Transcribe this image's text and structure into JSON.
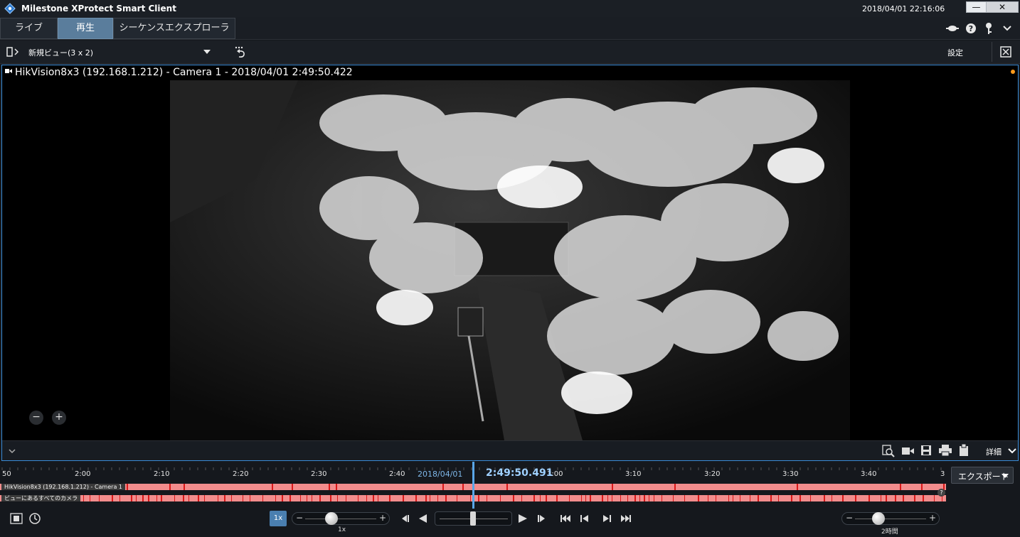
{
  "app": {
    "title": "Milestone XProtect Smart Client",
    "datetime": "2018/04/01 22:16:06"
  },
  "window_controls": {
    "minimize": "—",
    "maximize": "□",
    "close": "✕"
  },
  "tabs": [
    {
      "label": "ライブ",
      "active": false
    },
    {
      "label": "再生",
      "active": true
    },
    {
      "label": "シーケンスエクスプローラ",
      "active": false
    }
  ],
  "header_icons": [
    "status-icon",
    "help-icon",
    "key-icon",
    "chevron-down-icon"
  ],
  "view": {
    "name": "新規ビュー(3 x 2)",
    "settings_label": "設定"
  },
  "camera": {
    "title": "HikVision8x3 (192.168.1.212) - Camera 1 - 2018/04/01 2:49:50.422",
    "zoom_out": "−",
    "zoom_in": "+",
    "details_label": "詳細"
  },
  "timeline": {
    "ticks": [
      "50",
      "2:00",
      "2:10",
      "2:20",
      "2:30",
      "2:40",
      "3:00",
      "3:10",
      "3:20",
      "3:30",
      "3:40",
      "3"
    ],
    "date": "2018/04/01",
    "current_time": "2:49:50.491",
    "tracks": [
      {
        "label": "HikVision8x3 (192.168.1.212) - Camera 1"
      },
      {
        "label": "ビューにあるすべてのカメラ"
      }
    ],
    "help_badge": "?",
    "export_label": "エクスポート",
    "speed_badge": "1x",
    "speed_label": "1x",
    "span_label": "2時間",
    "minus": "−",
    "plus": "+"
  },
  "colors": {
    "accent": "#3a8bd6",
    "tab_active": "#5a7d9c",
    "recording": "#f28c8c",
    "motion": "#d91818",
    "current_time": "#9fd0ff"
  }
}
